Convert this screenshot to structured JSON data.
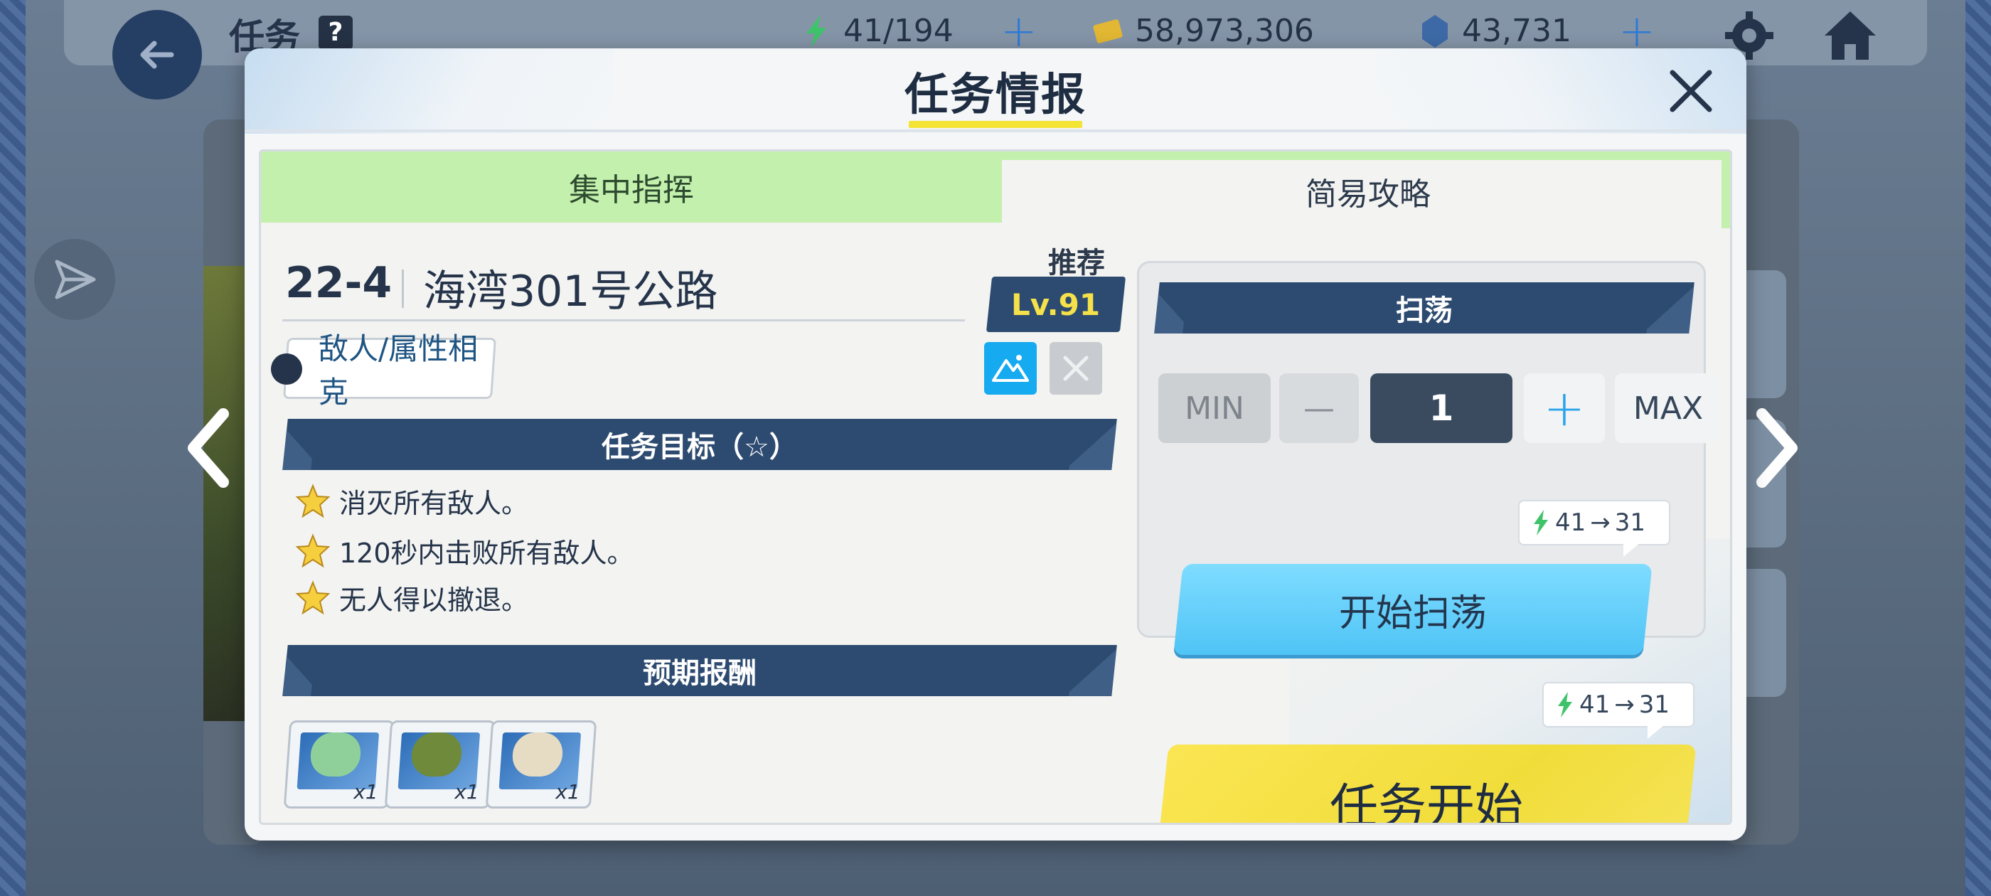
{
  "topbar": {
    "title": "任务",
    "help": "?",
    "ap": "41/194",
    "credits": "58,973,306",
    "gems": "43,731"
  },
  "modal": {
    "title": "任务情报",
    "tabs": [
      "集中指挥",
      "简易攻略"
    ],
    "stage_number": "22-4",
    "stage_name": "海湾301号公路",
    "recommend_label": "推荐",
    "recommend_level": "Lv.91",
    "enemy_button": "敌人/属性相克",
    "goal_header": "任务目标（☆）",
    "goals": [
      "消灭所有敌人。",
      "120秒内击败所有敌人。",
      "无人得以撤退。"
    ],
    "reward_header": "预期报酬",
    "rewards": [
      {
        "qty": "x1",
        "icon": "leaf-item-icon"
      },
      {
        "qty": "x1",
        "icon": "shoes-item-icon"
      },
      {
        "qty": "x1",
        "icon": "bag-item-icon"
      }
    ],
    "sweep": {
      "header": "扫荡",
      "min": "MIN",
      "minus": "—",
      "quantity": "1",
      "plus": "+",
      "max": "MAX",
      "ap_from": "41",
      "ap_to": "31",
      "button": "开始扫荡"
    },
    "start": {
      "ap_from": "41",
      "ap_to": "31",
      "button": "任务开始"
    }
  },
  "colors": {
    "navy": "#2d4b70",
    "tab_active": "#c4f0ad",
    "sweep_button": "#4fc4f6",
    "start_button": "#f1dd3a",
    "recommend_text": "#f5e14a"
  }
}
